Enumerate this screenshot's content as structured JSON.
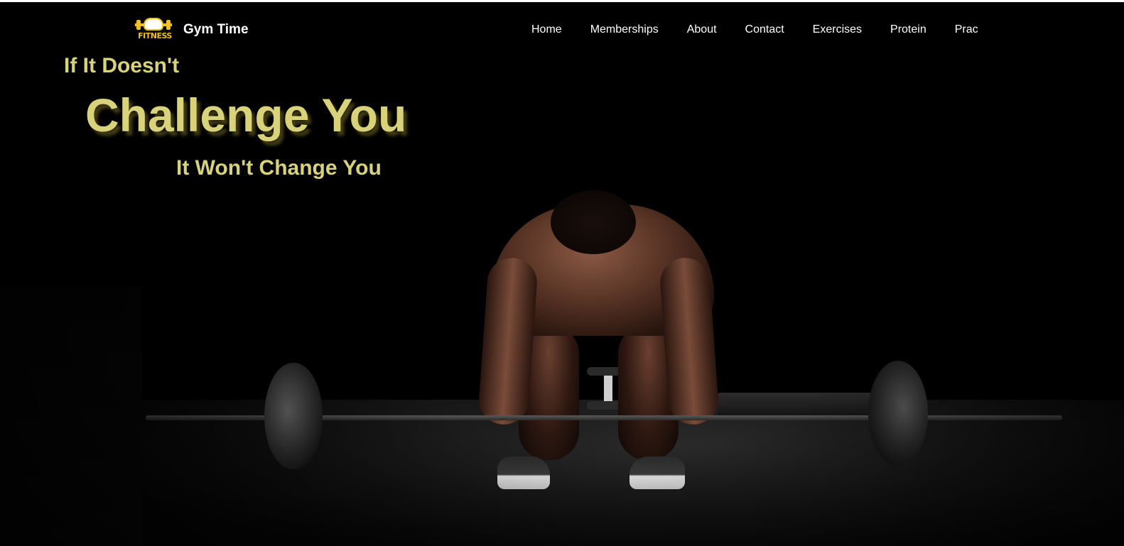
{
  "brand": {
    "logo_text": "FITNESS",
    "name": "Gym Time"
  },
  "nav": {
    "items": [
      {
        "label": "Home"
      },
      {
        "label": "Memberships"
      },
      {
        "label": "About"
      },
      {
        "label": "Contact"
      },
      {
        "label": "Exercises"
      },
      {
        "label": "Protein"
      },
      {
        "label": "Prac"
      }
    ]
  },
  "hero": {
    "line1": "If It Doesn't",
    "line2": "Challenge You",
    "line3": "It Won't Change You"
  },
  "colors": {
    "background": "#000000",
    "headline": "#d8d27a",
    "logo_accent": "#f2c21b",
    "nav_text": "#ffffff"
  }
}
